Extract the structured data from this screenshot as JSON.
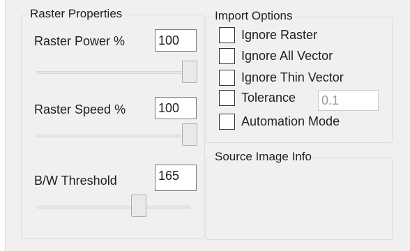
{
  "raster_properties": {
    "legend": "Raster Properties",
    "power": {
      "label": "Raster Power %",
      "value": "100",
      "slider_percent": 100
    },
    "speed": {
      "label": "Raster Speed %",
      "value": "100",
      "slider_percent": 100
    },
    "threshold": {
      "label": "B/W Threshold",
      "value": "165",
      "slider_percent": 65
    }
  },
  "import_options": {
    "legend": "Import Options",
    "ignore_raster": {
      "label": "Ignore Raster",
      "checked": false
    },
    "ignore_all_vector": {
      "label": "Ignore All Vector",
      "checked": false
    },
    "ignore_thin_vector": {
      "label": "Ignore Thin Vector",
      "checked": false
    },
    "tolerance": {
      "label": "Tolerance",
      "checked": false,
      "value": "0.1"
    },
    "automation_mode": {
      "label": "Automation Mode",
      "checked": false
    }
  },
  "source_image_info": {
    "legend": "Source Image Info"
  }
}
